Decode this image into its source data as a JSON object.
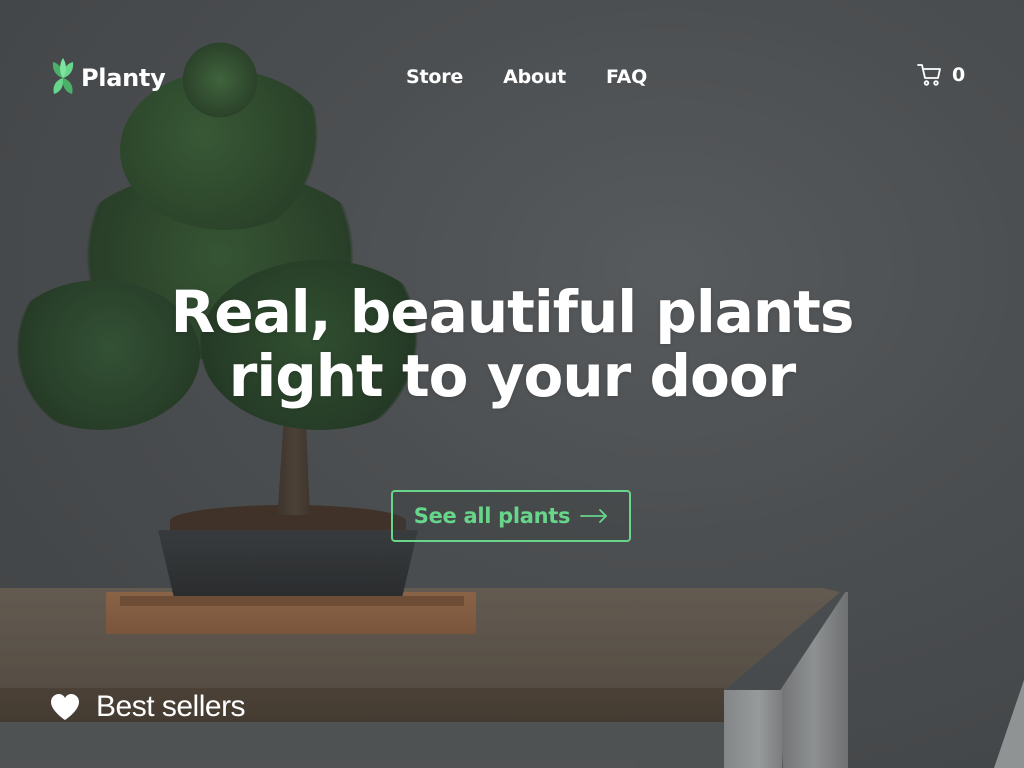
{
  "brand": {
    "name": "Planty",
    "logo_icon": "leaf-icon",
    "accent_color": "#67d58a"
  },
  "nav": {
    "items": [
      {
        "label": "Store"
      },
      {
        "label": "About"
      },
      {
        "label": "FAQ"
      }
    ]
  },
  "cart": {
    "icon": "cart-icon",
    "count": "0"
  },
  "hero": {
    "title_line1": "Real, beautiful plants",
    "title_line2": "right to your door",
    "cta_label": "See all plants",
    "cta_icon": "arrow-right-icon",
    "background_image": "bonsai-on-wooden-table"
  },
  "section": {
    "icon": "heart-icon",
    "title": "Best sellers"
  }
}
